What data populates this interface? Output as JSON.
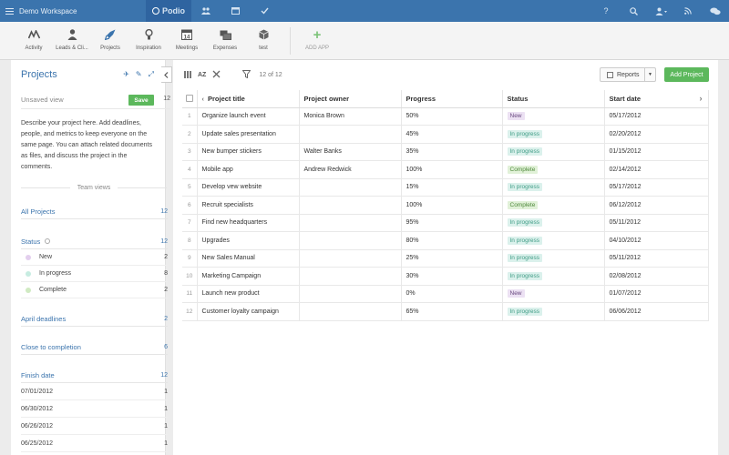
{
  "topbar": {
    "workspace": "Demo Workspace",
    "brand": "Podio",
    "nav_icons": [
      "people-icon",
      "calendar-icon",
      "check-icon"
    ],
    "right_icons": [
      "help-icon",
      "search-icon",
      "user-icon",
      "rss-icon",
      "chat-icon"
    ],
    "help_glyph": "?",
    "colors": {
      "bar": "#3b74ad",
      "active": "#2f64a0"
    }
  },
  "apps": [
    {
      "label": "Activity",
      "icon": "activity-icon",
      "glyph": "∿"
    },
    {
      "label": "Leads & Cli...",
      "icon": "person-icon",
      "glyph": "●"
    },
    {
      "label": "Projects",
      "icon": "rocket-icon",
      "glyph": "➶"
    },
    {
      "label": "Inspiration",
      "icon": "bulb-icon",
      "glyph": "♀"
    },
    {
      "label": "Meetings",
      "icon": "calendar-14-icon",
      "glyph": "14"
    },
    {
      "label": "Expenses",
      "icon": "cards-icon",
      "glyph": "▤"
    },
    {
      "label": "test",
      "icon": "box-icon",
      "glyph": "◆"
    }
  ],
  "add_app": {
    "label": "ADD APP",
    "glyph": "+"
  },
  "sidebar": {
    "title": "Projects",
    "tool_glyphs": [
      "✈",
      "✎",
      "⤢"
    ],
    "view_name": "Unsaved view",
    "save_label": "Save",
    "view_count": "12",
    "description": "Describe your project here. Add deadlines, people, and metrics to keep everyone on the same page. You can attach related documents as files, and discuss the project in the comments.",
    "team_views_label": "Team views",
    "all_projects": {
      "label": "All Projects",
      "count": "12"
    },
    "status": {
      "label": "Status",
      "count": "12",
      "items": [
        {
          "label": "New",
          "count": "2",
          "color": "#e3cfee"
        },
        {
          "label": "In progress",
          "count": "8",
          "color": "#c7ece1"
        },
        {
          "label": "Complete",
          "count": "2",
          "color": "#d0eac2"
        }
      ]
    },
    "april_deadlines": {
      "label": "April deadlines",
      "count": "2"
    },
    "close_to_completion": {
      "label": "Close to completion",
      "count": "6"
    },
    "finish_date": {
      "label": "Finish date",
      "count": "12",
      "items": [
        {
          "date": "07/01/2012",
          "count": "1"
        },
        {
          "date": "06/30/2012",
          "count": "1"
        },
        {
          "date": "06/26/2012",
          "count": "1"
        },
        {
          "date": "06/25/2012",
          "count": "1"
        }
      ]
    }
  },
  "toolbar": {
    "count_text": "12 of 12",
    "sort_label": "AZ",
    "reports_label": "Reports",
    "add_project_label": "Add Project"
  },
  "table": {
    "columns": [
      "Project title",
      "Project owner",
      "Progress",
      "Status",
      "Start date"
    ],
    "rows": [
      {
        "n": "1",
        "title": "Organize launch event",
        "owner": "Monica Brown",
        "progress": "50%",
        "status": "New",
        "start": "05/17/2012"
      },
      {
        "n": "2",
        "title": "Update sales presentation",
        "owner": "",
        "progress": "45%",
        "status": "In progress",
        "start": "02/20/2012"
      },
      {
        "n": "3",
        "title": "New bumper stickers",
        "owner": "Walter Banks",
        "progress": "35%",
        "status": "In progress",
        "start": "01/15/2012"
      },
      {
        "n": "4",
        "title": "Mobile app",
        "owner": "Andrew Redwick",
        "progress": "100%",
        "status": "Complete",
        "start": "02/14/2012"
      },
      {
        "n": "5",
        "title": "Develop vew website",
        "owner": "",
        "progress": "15%",
        "status": "In progress",
        "start": "05/17/2012"
      },
      {
        "n": "6",
        "title": "Recruit specialists",
        "owner": "",
        "progress": "100%",
        "status": "Complete",
        "start": "06/12/2012"
      },
      {
        "n": "7",
        "title": "Find new headquarters",
        "owner": "",
        "progress": "95%",
        "status": "In progress",
        "start": "05/11/2012"
      },
      {
        "n": "8",
        "title": "Upgrades",
        "owner": "",
        "progress": "80%",
        "status": "In progress",
        "start": "04/10/2012"
      },
      {
        "n": "9",
        "title": "New Sales Manual",
        "owner": "",
        "progress": "25%",
        "status": "In progress",
        "start": "05/11/2012"
      },
      {
        "n": "10",
        "title": "Marketing Campaign",
        "owner": "",
        "progress": "30%",
        "status": "In progress",
        "start": "02/08/2012"
      },
      {
        "n": "11",
        "title": "Launch new product",
        "owner": "",
        "progress": "0%",
        "status": "New",
        "start": "01/07/2012"
      },
      {
        "n": "12",
        "title": "Customer loyalty campaign",
        "owner": "",
        "progress": "65%",
        "status": "In progress",
        "start": "06/06/2012"
      }
    ]
  }
}
